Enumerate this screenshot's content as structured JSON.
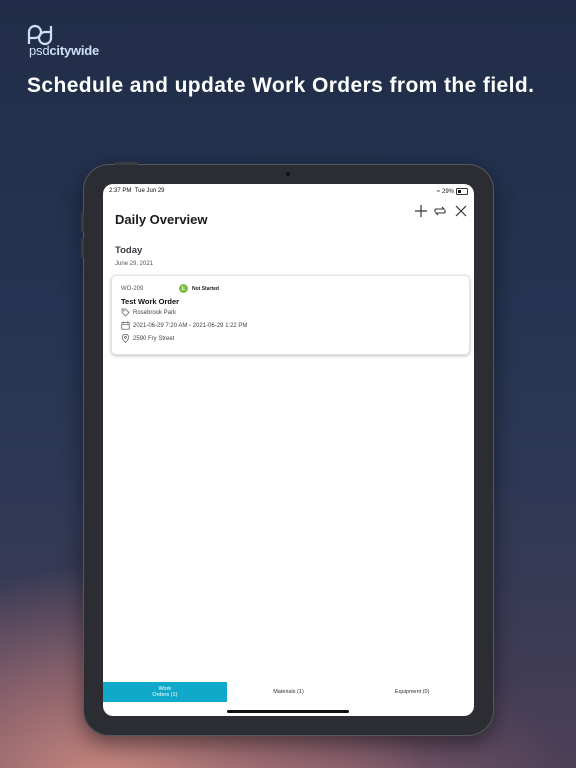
{
  "brand": {
    "logo_prefix": "psd",
    "logo_suffix": "citywide"
  },
  "headline": "Schedule and update Work Orders from the field.",
  "status_bar": {
    "time": "2:37 PM",
    "date": "Tue Jun 29",
    "battery": "29%"
  },
  "header": {
    "title": "Daily Overview"
  },
  "section": {
    "title": "Today",
    "date": "June 29, 2021"
  },
  "work_order": {
    "id": "WO-209",
    "status_badge": "L",
    "status": "Not Started",
    "title": "Test Work Order",
    "location": "Rosebrook Park",
    "schedule": "2021-06-29 7:20 AM - 2021-06-29 1:22 PM",
    "address": "2590 Fry Street"
  },
  "tabs": [
    {
      "label_line1": "Work",
      "label_line2": "Orders (1)"
    },
    {
      "label_line1": "Materials (1)"
    },
    {
      "label_line1": "Equipment (0)"
    }
  ],
  "colors": {
    "accent": "#10a9c9",
    "status_green": "#7bc043",
    "logo_light": "#cfe0f5",
    "background_top": "#212d48"
  },
  "icons": {
    "header": [
      "plus-icon",
      "sync-icon",
      "close-icon"
    ],
    "card": [
      "tag-icon",
      "calendar-icon",
      "location-pin-icon"
    ]
  }
}
